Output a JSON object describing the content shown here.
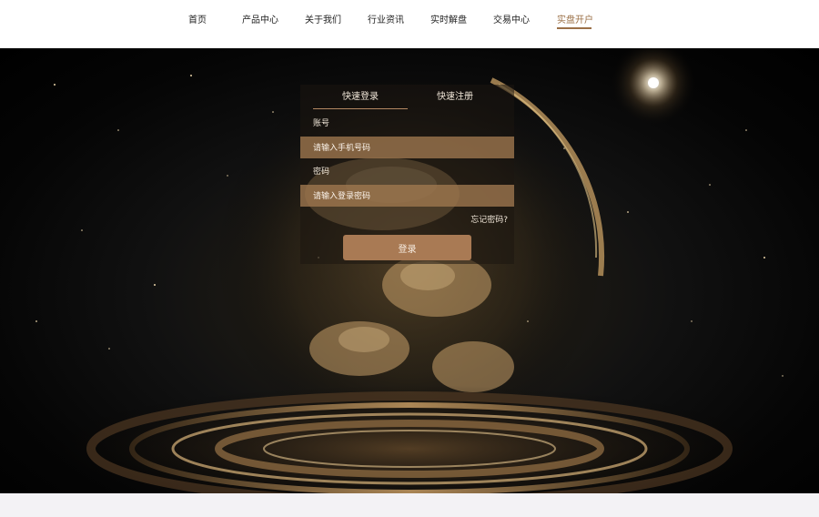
{
  "nav": {
    "items": [
      {
        "label": "首页"
      },
      {
        "label": "产品中心"
      },
      {
        "label": "关于我们"
      },
      {
        "label": "行业资讯"
      },
      {
        "label": "实时解盘"
      },
      {
        "label": "交易中心"
      },
      {
        "label": "实盘开户"
      }
    ],
    "active_index": 6
  },
  "login": {
    "tabs": [
      {
        "label": "快速登录"
      },
      {
        "label": "快速注册"
      }
    ],
    "active_tab": 0,
    "account_label": "账号",
    "account_placeholder": "请输入手机号码",
    "account_value": "",
    "password_label": "密码",
    "password_placeholder": "请输入登录密码",
    "password_value": "",
    "forgot_label": "忘记密码?",
    "submit_label": "登录"
  },
  "colors": {
    "accent": "#9b7047",
    "button": "#a97a54",
    "input_bg": "#a07850",
    "nav_bg": "#ffffff"
  }
}
